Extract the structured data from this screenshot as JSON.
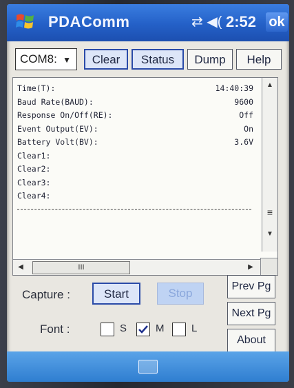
{
  "titlebar": {
    "app_title": "PDAComm",
    "status_icons": "⇄ ◀(",
    "clock": "2:52",
    "ok_label": "ok"
  },
  "toolbar": {
    "port_value": "COM8:",
    "clear_label": "Clear",
    "status_label": "Status",
    "dump_label": "Dump",
    "help_label": "Help"
  },
  "log": {
    "lines": [
      {
        "key": "Time(T):",
        "value": "14:40:39"
      },
      {
        "key": "Baud Rate(BAUD):",
        "value": "9600"
      },
      {
        "key": "Response On/Off(RE):",
        "value": "Off"
      },
      {
        "key": "Event Output(EV):",
        "value": "On"
      },
      {
        "key": "Battery Volt(BV):",
        "value": "3.6V"
      },
      {
        "key": "Clear1:",
        "value": ""
      },
      {
        "key": "Clear2:",
        "value": ""
      },
      {
        "key": "Clear3:",
        "value": ""
      },
      {
        "key": "Clear4:",
        "value": ""
      }
    ],
    "hscroll_thumb_glyph": "III"
  },
  "capture": {
    "label": "Capture :",
    "start_label": "Start",
    "stop_label": "Stop"
  },
  "font": {
    "label": "Font :",
    "small_label": "S",
    "medium_label": "M",
    "large_label": "L",
    "small_checked": false,
    "medium_checked": true,
    "large_checked": false
  },
  "nav": {
    "prev_label": "Prev Pg",
    "next_label": "Next Pg",
    "about_label": "About"
  },
  "colors": {
    "titlebar_accent": "#2460c7",
    "button_border_active": "#2a4ba8",
    "sip_bar": "#2f7ed0"
  },
  "icons": [
    "windows-start-icon",
    "connectivity-icon",
    "volume-icon",
    "dropdown-arrow-icon",
    "scroll-up-icon",
    "scroll-down-icon",
    "scroll-left-icon",
    "scroll-right-icon",
    "keyboard-icon"
  ]
}
